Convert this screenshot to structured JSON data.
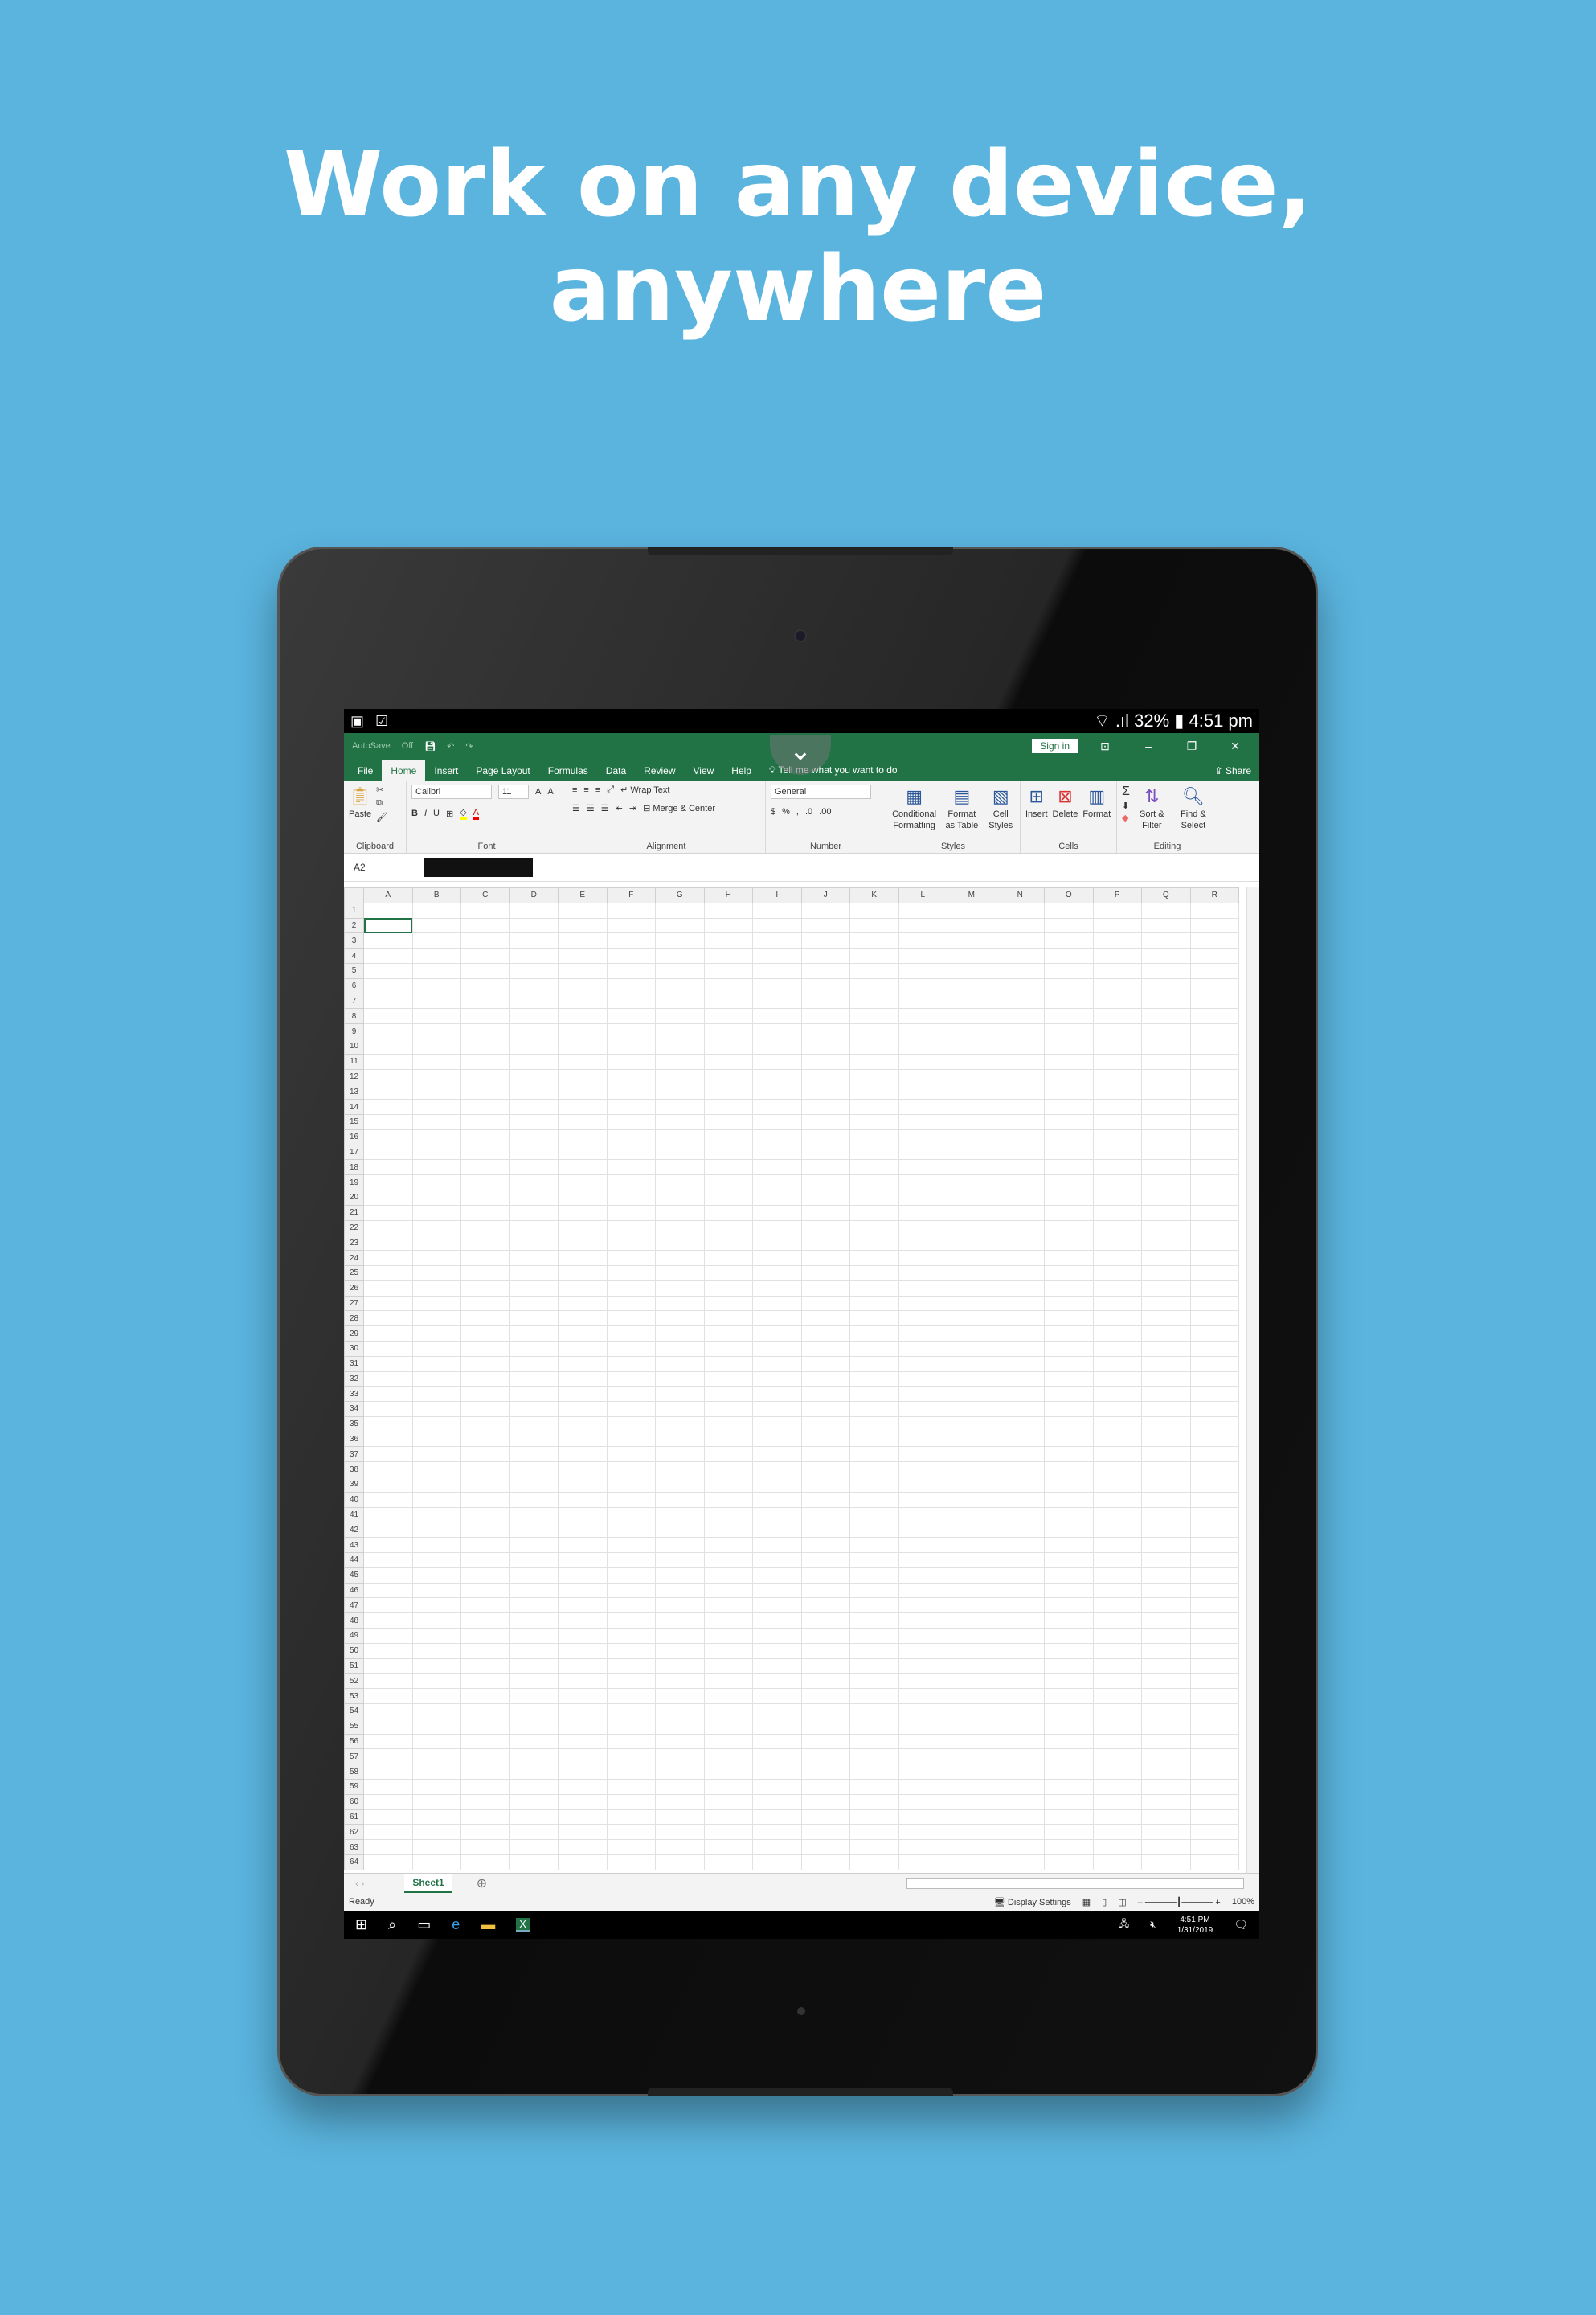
{
  "headline": {
    "line1": "Work on any device,",
    "line2": "anywhere"
  },
  "android": {
    "signal": "32%",
    "time": "4:51 pm"
  },
  "excel": {
    "autosave": "AutoSave",
    "autosave_state": "Off",
    "sign_in": "Sign in",
    "accent": "#217346",
    "tabs": [
      "File",
      "Home",
      "Insert",
      "Page Layout",
      "Formulas",
      "Data",
      "Review",
      "View",
      "Help"
    ],
    "active_tab": "Home",
    "tell_me": "Tell me what you want to do",
    "share": "Share",
    "ribbon": {
      "paste": "Paste",
      "clipboard": "Clipboard",
      "font_name": "Calibri",
      "font_size": "11",
      "font": "Font",
      "wrap_text": "Wrap Text",
      "merge_center": "Merge & Center",
      "alignment": "Alignment",
      "number_format": "General",
      "number": "Number",
      "conditional": "Conditional Formatting",
      "format_table": "Format as Table",
      "cell_styles": "Cell Styles",
      "styles": "Styles",
      "insert": "Insert",
      "delete": "Delete",
      "format": "Format",
      "cells": "Cells",
      "sort_filter": "Sort & Filter",
      "find_select": "Find & Select",
      "editing": "Editing"
    },
    "name_box": "A2",
    "columns": [
      "A",
      "B",
      "C",
      "D",
      "E",
      "F",
      "G",
      "H",
      "I",
      "J",
      "K",
      "L",
      "M",
      "N",
      "O",
      "P",
      "Q",
      "R"
    ],
    "row_count": 64,
    "selected_cell": "A2",
    "sheet": "Sheet1",
    "status": "Ready",
    "display_settings": "Display Settings",
    "zoom": "100%"
  },
  "taskbar": {
    "time": "4:51 PM",
    "date": "1/31/2019"
  }
}
